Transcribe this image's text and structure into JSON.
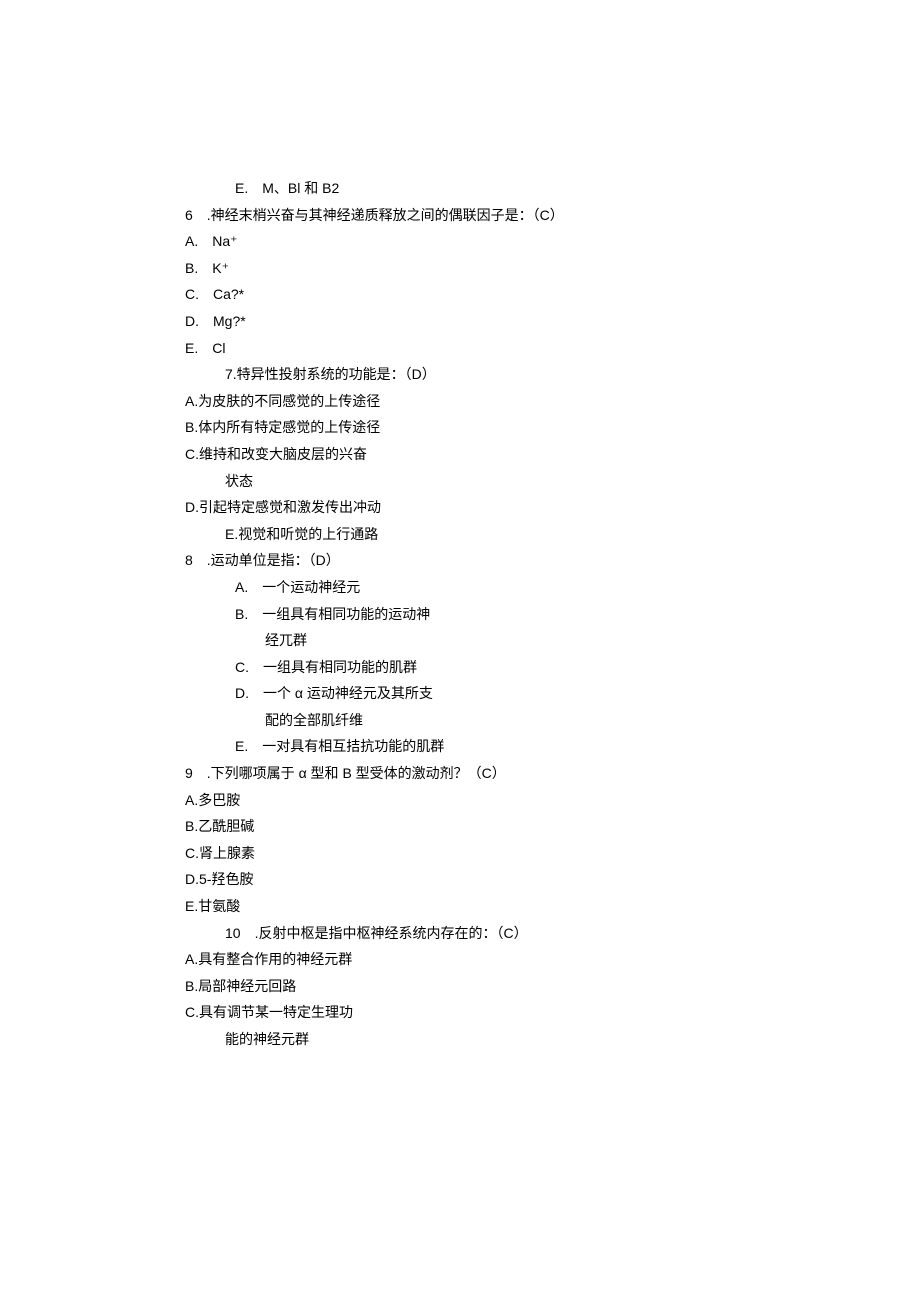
{
  "lines": [
    {
      "text": "E.　M、Bl 和 B2",
      "cls": "indent-1"
    },
    {
      "text": "6　.神经末梢兴奋与其神经递质释放之间的偶联因子是：（C）",
      "cls": ""
    },
    {
      "text": "A.　Na⁺",
      "cls": ""
    },
    {
      "text": "B.　K⁺",
      "cls": ""
    },
    {
      "text": "C.　Ca?*",
      "cls": ""
    },
    {
      "text": "D.　Mg?*",
      "cls": ""
    },
    {
      "text": "E.　Cl",
      "cls": ""
    },
    {
      "text": "7.特异性投射系统的功能是：（D）",
      "cls": "indent-3"
    },
    {
      "text": "A.为皮肤的不同感觉的上传途径",
      "cls": ""
    },
    {
      "text": "B.体内所有特定感觉的上传途径",
      "cls": ""
    },
    {
      "text": "C.维持和改变大脑皮层的兴奋",
      "cls": ""
    },
    {
      "text": "状态",
      "cls": "indent-3"
    },
    {
      "text": "D.引起特定感觉和激发传出冲动",
      "cls": ""
    },
    {
      "text": "E.视觉和听觉的上行通路",
      "cls": "indent-3"
    },
    {
      "text": "8　.运动单位是指：（D）",
      "cls": ""
    },
    {
      "text": "A.　一个运动神经元",
      "cls": "indent-1"
    },
    {
      "text": "B.　一组具有相同功能的运动神",
      "cls": "indent-1"
    },
    {
      "text": "经兀群",
      "cls": "indent-1 pad"
    },
    {
      "text": "C.　一组具有相同功能的肌群",
      "cls": "indent-1"
    },
    {
      "text": "D.　一个 α 运动神经元及其所支",
      "cls": "indent-1"
    },
    {
      "text": "配的全部肌纤维",
      "cls": "indent-1 pad"
    },
    {
      "text": "E.　一对具有相互拮抗功能的肌群",
      "cls": "indent-1"
    },
    {
      "text": "9　.下列哪项属于 α 型和 B 型受体的激动剂？（C）",
      "cls": ""
    },
    {
      "text": "A.多巴胺",
      "cls": ""
    },
    {
      "text": "B.乙酰胆碱",
      "cls": ""
    },
    {
      "text": "C.肾上腺素",
      "cls": ""
    },
    {
      "text": "D.5-羟色胺",
      "cls": ""
    },
    {
      "text": "E.甘氨酸",
      "cls": ""
    },
    {
      "text": "10　.反射中枢是指中枢神经系统内存在的：（C）",
      "cls": "indent-3"
    },
    {
      "text": "A.具有整合作用的神经元群",
      "cls": ""
    },
    {
      "text": "B.局部神经元回路",
      "cls": ""
    },
    {
      "text": "C.具有调节某一特定生理功",
      "cls": ""
    },
    {
      "text": "能的神经元群",
      "cls": "indent-3"
    }
  ]
}
